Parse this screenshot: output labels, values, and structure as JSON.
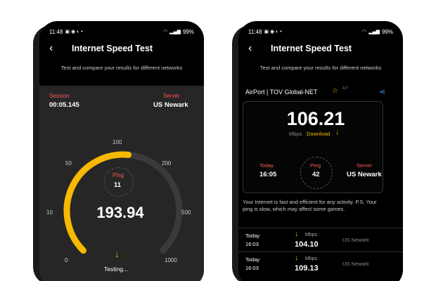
{
  "status_bar": {
    "time": "11:48",
    "battery": "99%"
  },
  "left": {
    "title": "Internet Speed Test",
    "subtitle": "Test and compare your results for different networks",
    "session_label": "Session",
    "session_value": "00:05.145",
    "server_label": "Server",
    "server_value": "US Newark",
    "gauge_ticks": [
      "0",
      "10",
      "50",
      "100",
      "200",
      "500",
      "1000"
    ],
    "gauge_progress_fraction": 0.52,
    "ping_label": "Ping",
    "ping_value": "11",
    "speed": "193.94",
    "state": "Testing..."
  },
  "right": {
    "title": "Internet Speed Test",
    "subtitle": "Test and compare your results for different networks",
    "provider": "AirPort | TOV Global-NET",
    "rating": "3.7",
    "result_speed": "106.21",
    "result_unit": "Mbps",
    "result_direction": "Download",
    "today_label": "Today",
    "today_value": "16:05",
    "ping_label": "Ping",
    "ping_value": "42",
    "server_label": "Server",
    "server_value": "US Newark",
    "summary": "Your Internet is fast and efficient for any activity. P.S. Your ping is slow, which may affect some games.",
    "history": [
      {
        "day": "Today",
        "time": "16:03",
        "unit": "Mbps",
        "speed": "104.10",
        "server": "US Newark"
      },
      {
        "day": "Today",
        "time": "16:03",
        "unit": "Mbps",
        "speed": "109.13",
        "server": "US Newark"
      }
    ]
  },
  "colors": {
    "accent": "#f6b800",
    "label": "#ff5a4f",
    "share": "#3b8cff",
    "panel": "#262626"
  }
}
